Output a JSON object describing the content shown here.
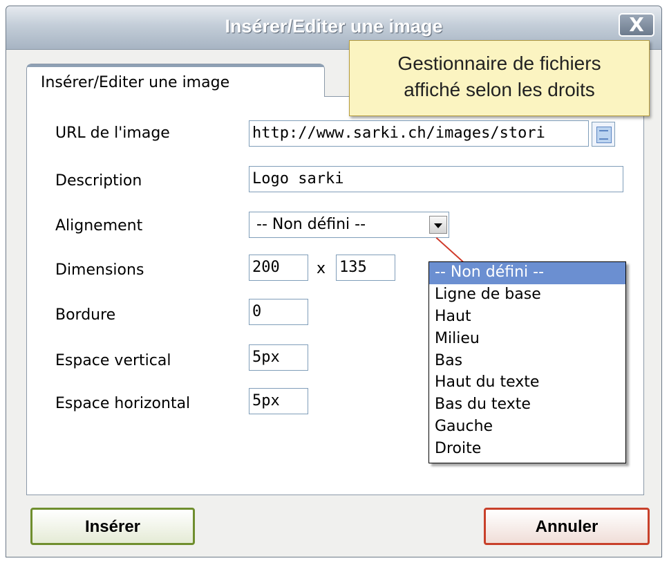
{
  "dialog": {
    "title": "Insérer/Editer une image",
    "close_label": "X"
  },
  "tab": {
    "label": "Insérer/Editer une image"
  },
  "tooltip": {
    "line1": "Gestionnaire de fichiers",
    "line2": "affiché selon les droits"
  },
  "form": {
    "url_label": "URL de l'image",
    "url_value": "http://www.sarki.ch/images/stori",
    "description_label": "Description",
    "description_value": "Logo sarki",
    "alignment_label": "Alignement",
    "alignment_value": "-- Non défini --",
    "alignment_options": [
      "-- Non défini --",
      "Ligne de base",
      "Haut",
      "Milieu",
      "Bas",
      "Haut du texte",
      "Bas du texte",
      "Gauche",
      "Droite"
    ],
    "dimensions_label": "Dimensions",
    "width_value": "200",
    "times_symbol": "x",
    "height_value": "135",
    "border_label": "Bordure",
    "border_value": "0",
    "vspace_label": "Espace vertical",
    "vspace_value": "5px",
    "hspace_label": "Espace horizontal",
    "hspace_value": "5px"
  },
  "buttons": {
    "insert": "Insérer",
    "cancel": "Annuler"
  },
  "colors": {
    "insert_border": "#6f8e2e",
    "cancel_border": "#c8402a",
    "selected_option": "#6b8fd1",
    "tooltip_bg": "#fbf4c1"
  },
  "icons": {
    "browse": "file-browser-icon",
    "dropdown": "chevron-down-icon",
    "close": "close-icon"
  }
}
